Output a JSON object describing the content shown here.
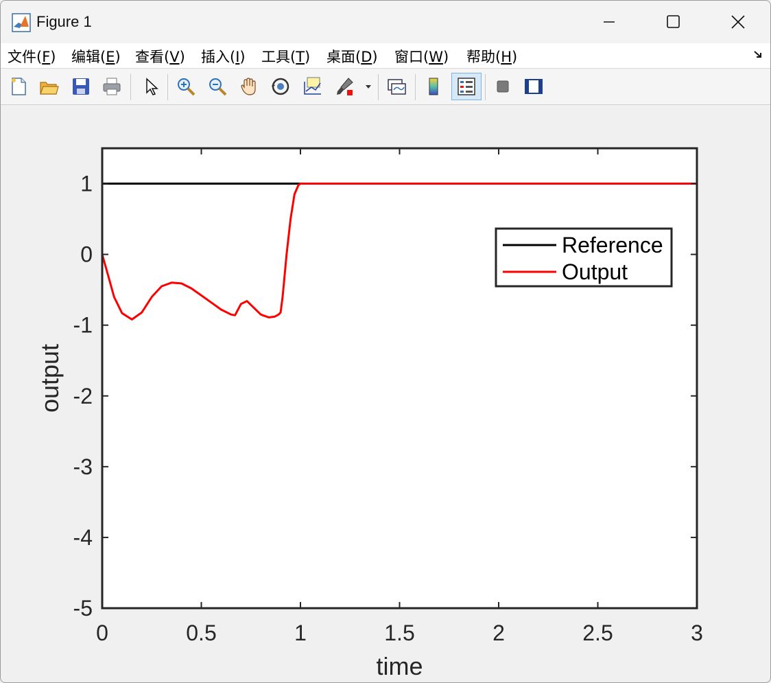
{
  "window": {
    "title": "Figure 1",
    "icon": "matlab-logo-icon"
  },
  "menu": [
    {
      "label": "文件(",
      "key": "F",
      "tail": ")"
    },
    {
      "label": "编辑(",
      "key": "E",
      "tail": ")"
    },
    {
      "label": "查看(",
      "key": "V",
      "tail": ")"
    },
    {
      "label": "插入(",
      "key": "I",
      "tail": ")"
    },
    {
      "label": "工具(",
      "key": "T",
      "tail": ")"
    },
    {
      "label": "桌面(",
      "key": "D",
      "tail": ")"
    },
    {
      "label": "窗口(",
      "key": "W",
      "tail": ")"
    },
    {
      "label": "帮助(",
      "key": "H",
      "tail": ")"
    }
  ],
  "toolbar": [
    "new-figure-icon",
    "open-file-icon",
    "save-icon",
    "print-icon",
    "pointer-icon",
    "zoom-in-icon",
    "zoom-out-icon",
    "pan-hand-icon",
    "rotate-3d-icon",
    "data-cursor-icon",
    "brush-icon",
    "link-plot-icon",
    "colorbar-icon",
    "legend-icon",
    "hide-plot-tools-icon",
    "show-plot-tools-icon"
  ],
  "chart_data": {
    "type": "line",
    "xlabel": "time",
    "ylabel": "output",
    "xlim": [
      0,
      3
    ],
    "ylim": [
      -5,
      1.5
    ],
    "xticks": [
      "0",
      "0.5",
      "1",
      "1.5",
      "2",
      "2.5",
      "3"
    ],
    "yticks": [
      "1",
      "0",
      "-1",
      "-2",
      "-3",
      "-4",
      "-5"
    ],
    "grid": false,
    "legend_position": "top-right",
    "series": [
      {
        "name": "Reference",
        "color": "#000000",
        "x": [
          0,
          3
        ],
        "y": [
          1,
          1
        ]
      },
      {
        "name": "Output",
        "color": "#ff0000",
        "x": [
          0,
          0.03,
          0.06,
          0.1,
          0.15,
          0.2,
          0.25,
          0.3,
          0.35,
          0.4,
          0.45,
          0.5,
          0.55,
          0.6,
          0.65,
          0.67,
          0.7,
          0.73,
          0.76,
          0.8,
          0.84,
          0.87,
          0.89,
          0.9,
          0.91,
          0.93,
          0.95,
          0.97,
          0.99,
          1.0,
          1.5,
          2.0,
          2.5,
          3.0
        ],
        "y": [
          0,
          -0.3,
          -0.6,
          -0.83,
          -0.92,
          -0.82,
          -0.6,
          -0.45,
          -0.4,
          -0.41,
          -0.48,
          -0.58,
          -0.68,
          -0.78,
          -0.85,
          -0.86,
          -0.7,
          -0.66,
          -0.74,
          -0.85,
          -0.89,
          -0.88,
          -0.85,
          -0.82,
          -0.6,
          0.0,
          0.5,
          0.85,
          0.98,
          1.0,
          1.0,
          1.0,
          1.0,
          1.0
        ]
      }
    ]
  }
}
